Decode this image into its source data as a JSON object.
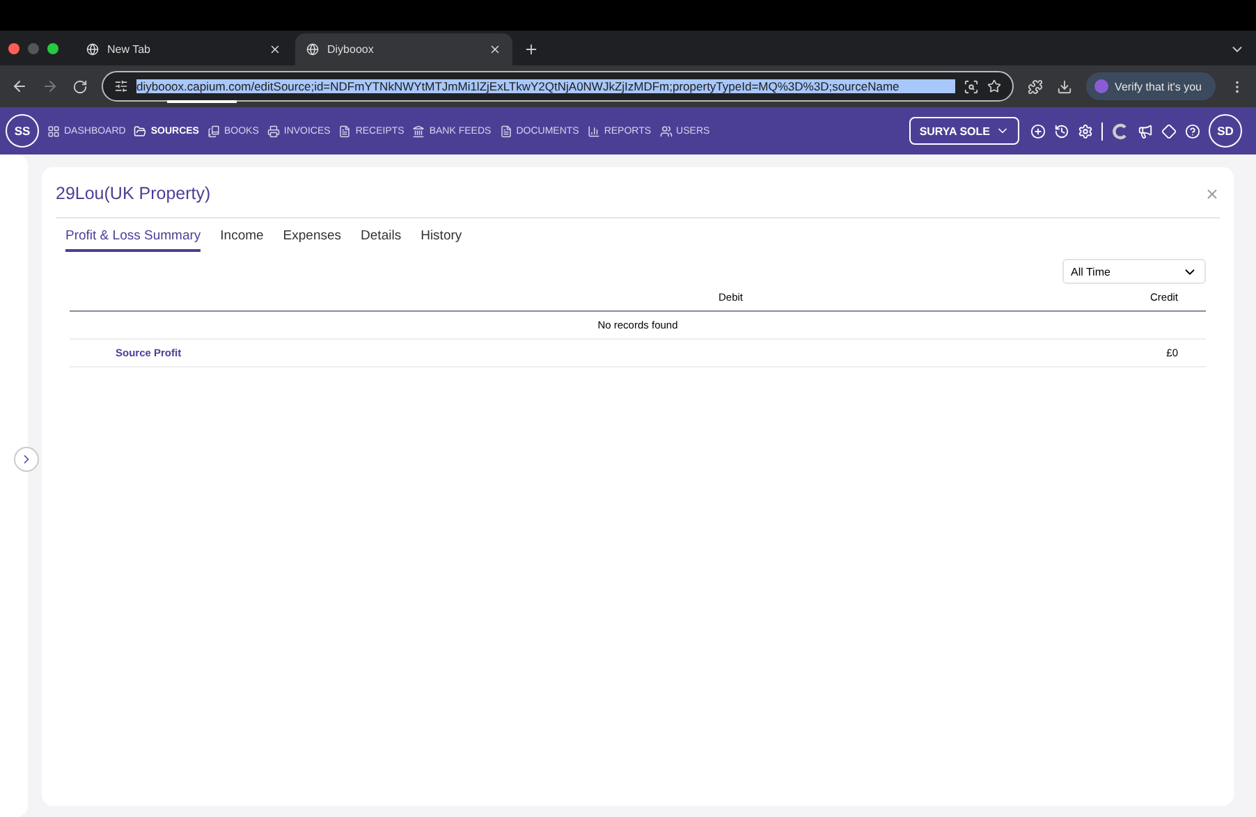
{
  "browser": {
    "tabs": [
      {
        "title": "New Tab",
        "selected": false
      },
      {
        "title": "Diybooox",
        "selected": true
      }
    ],
    "url": "diybooox.capium.com/editSource;id=NDFmYTNkNWYtMTJmMi1lZjExLTkwY2QtNjA0NWJkZjIzMDFm;propertyTypeId=MQ%3D%3D;sourceName",
    "profile_chip": "Verify that it's you"
  },
  "nav": {
    "avatar": "SS",
    "items": [
      {
        "label": "DASHBOARD",
        "selected": false
      },
      {
        "label": "SOURCES",
        "selected": true
      },
      {
        "label": "BOOKS",
        "selected": false
      },
      {
        "label": "INVOICES",
        "selected": false
      },
      {
        "label": "RECEIPTS",
        "selected": false
      },
      {
        "label": "BANK FEEDS",
        "selected": false
      },
      {
        "label": "DOCUMENTS",
        "selected": false
      },
      {
        "label": "REPORTS",
        "selected": false
      },
      {
        "label": "USERS",
        "selected": false
      }
    ],
    "client": "SURYA SOLE",
    "user_avatar": "SD"
  },
  "page": {
    "title": "29Lou(UK Property)",
    "tabs": [
      {
        "label": "Profit & Loss Summary",
        "selected": true
      },
      {
        "label": "Income",
        "selected": false
      },
      {
        "label": "Expenses",
        "selected": false
      },
      {
        "label": "Details",
        "selected": false
      },
      {
        "label": "History",
        "selected": false
      }
    ],
    "period": "All Time",
    "columns": [
      "Debit",
      "Credit"
    ],
    "empty_message": "No records found",
    "total": {
      "label": "Source Profit",
      "credit": "£0"
    }
  }
}
